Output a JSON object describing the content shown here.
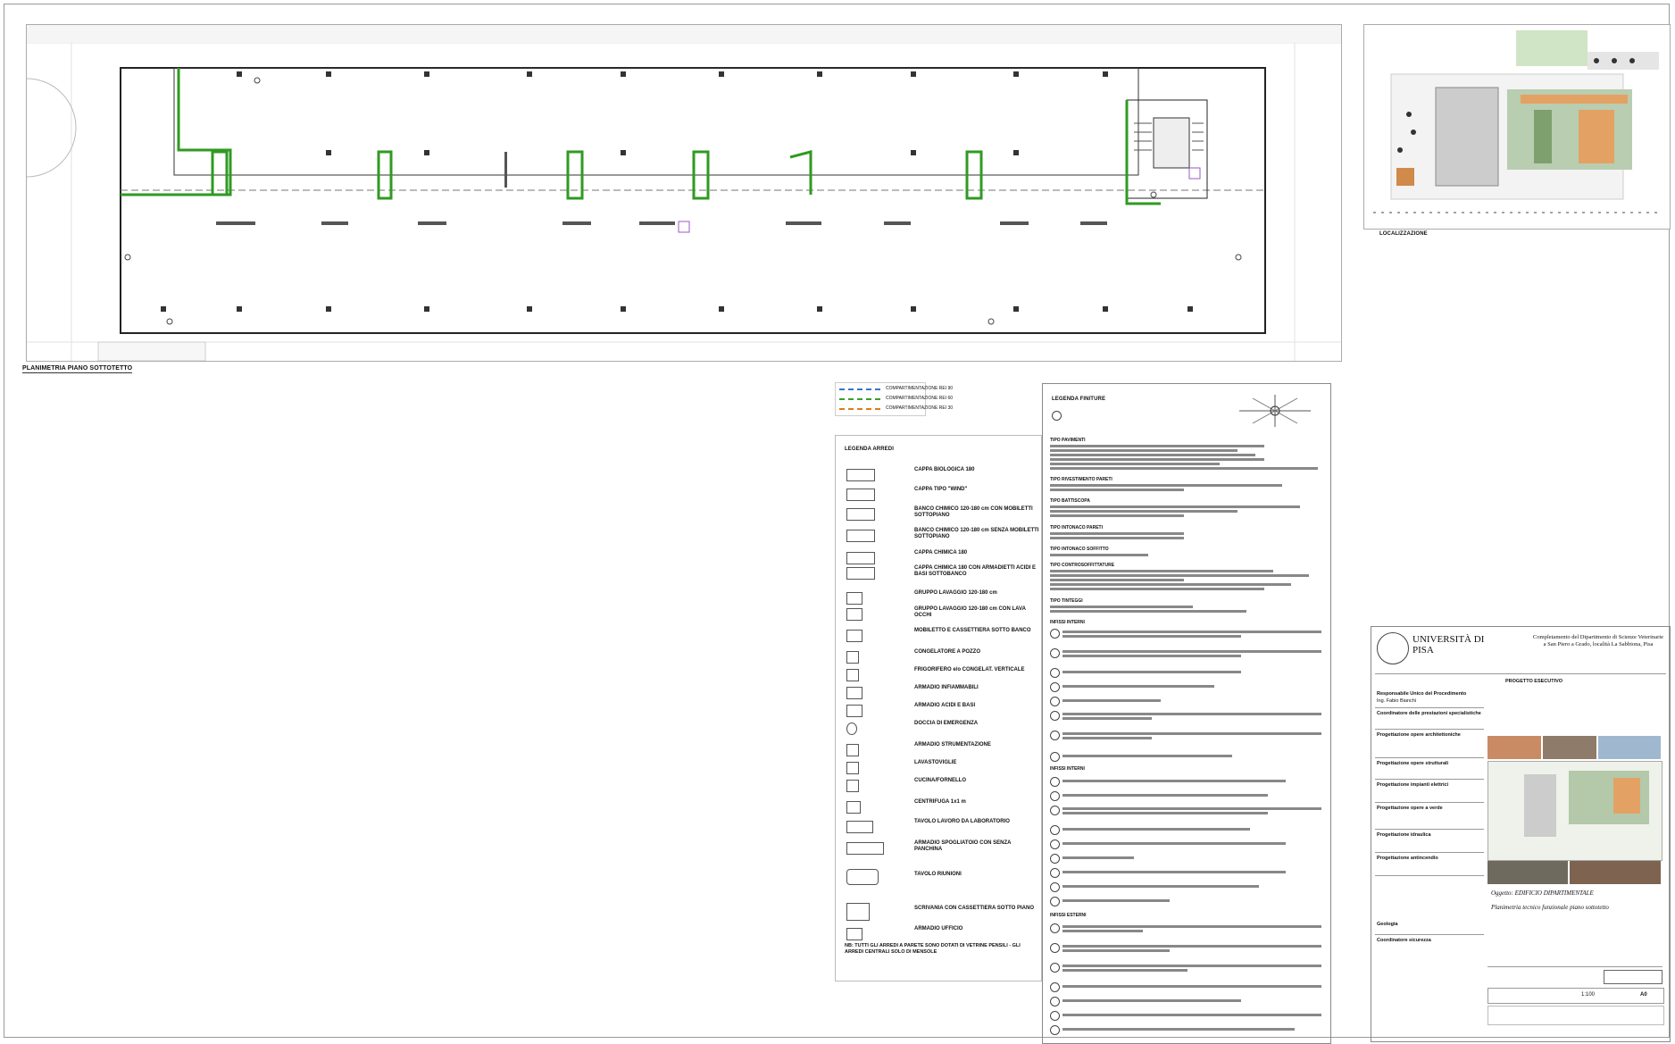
{
  "plan": {
    "caption": "PLANIMETRIA PIANO SOTTOTETTO"
  },
  "localizzazione": {
    "caption": "LOCALIZZAZIONE"
  },
  "compartimentazione": {
    "items": [
      "COMPARTIMENTAZIONE REI 90",
      "COMPARTIMENTAZIONE REI 60",
      "COMPARTIMENTAZIONE REI 30"
    ],
    "colors": [
      "#3a6fd8",
      "#36a02b",
      "#e07b1a"
    ]
  },
  "legenda_arredi": {
    "title": "LEGENDA ARREDI",
    "items": [
      "CAPPA BIOLOGICA 180",
      "CAPPA TIPO \"WIND\"",
      "BANCO CHIMICO 120-180 cm CON MOBILETTI SOTTOPIANO",
      "BANCO CHIMICO 120-180 cm SENZA MOBILETTI SOTTOPIANO",
      "CAPPA CHIMICA 180",
      "CAPPA CHIMICA 180 CON ARMADIETTI ACIDI E BASI SOTTOBANCO",
      "GRUPPO LAVAGGIO 120-180 cm",
      "GRUPPO LAVAGGIO 120-180 cm CON LAVA OCCHI",
      "MOBILETTO E CASSETTIERA SOTTO BANCO",
      "CONGELATORE A POZZO",
      "FRIGORIFERO e/o CONGELAT. VERTICALE",
      "ARMADIO INFIAMMABILI",
      "ARMADIO ACIDI E BASI",
      "DOCCIA DI EMERGENZA",
      "ARMADIO STRUMENTAZIONE",
      "LAVASTOVIGLIE",
      "CUCINA/FORNELLO",
      "CENTRIFUGA 1x1 m",
      "TAVOLO LAVORO DA LABORATORIO",
      "ARMADIO SPOGLIATOIO CON SENZA PANCHINA",
      "TAVOLO RIUNIONI",
      "SCRIVANIA CON CASSETTIERA SOTTO PIANO",
      "ARMADIO UFFICIO"
    ],
    "note": "NB: TUTTI GLI ARREDI A PARETE SONO DOTATI DI VETRINE PENSILI - GLI ARREDI CENTRALI SOLO DI MENSOLE"
  },
  "legenda_finiture": {
    "title": "LEGENDA FINITURE",
    "sections": [
      "TIPO PAVIMENTI",
      "TIPO RIVESTIMENTO PARETI",
      "TIPO BATTISCOPA",
      "TIPO INTONACO PARETI",
      "TIPO INTONACO SOFFITTO",
      "TIPO CONTROSOFFITTATURE",
      "TIPO TINTEGGI",
      "INFISSI INTERNI",
      "INFISSI ESTERNI"
    ]
  },
  "cartiglio": {
    "university": "UNIVERSITÀ DI PISA",
    "project_title": "Completamento del Dipartimento di Scienze Veterinarie a San Piero a Grado, località La Sabbiona, Pisa",
    "fase": "PROGETTO ESECUTIVO",
    "rows": [
      "Responsabile Unico del Procedimento",
      "Ing. Fabio Bianchi",
      "Coordinatore delle prestazioni specialistiche",
      "Progettazione opere architettoniche",
      "Progettazione opere strutturali",
      "Progettazione impianti elettrici",
      "Progettazione opere a verde",
      "Progettazione idraulica",
      "Progettazione antincendio",
      "Geologia",
      "Coordinatore sicurezza"
    ],
    "oggetto": "Oggetto: EDIFICIO DIPARTIMENTALE",
    "descrizione": "Planimetria tecnico funzionale piano sottotetto",
    "scala": "1:100",
    "formato": "A0"
  }
}
